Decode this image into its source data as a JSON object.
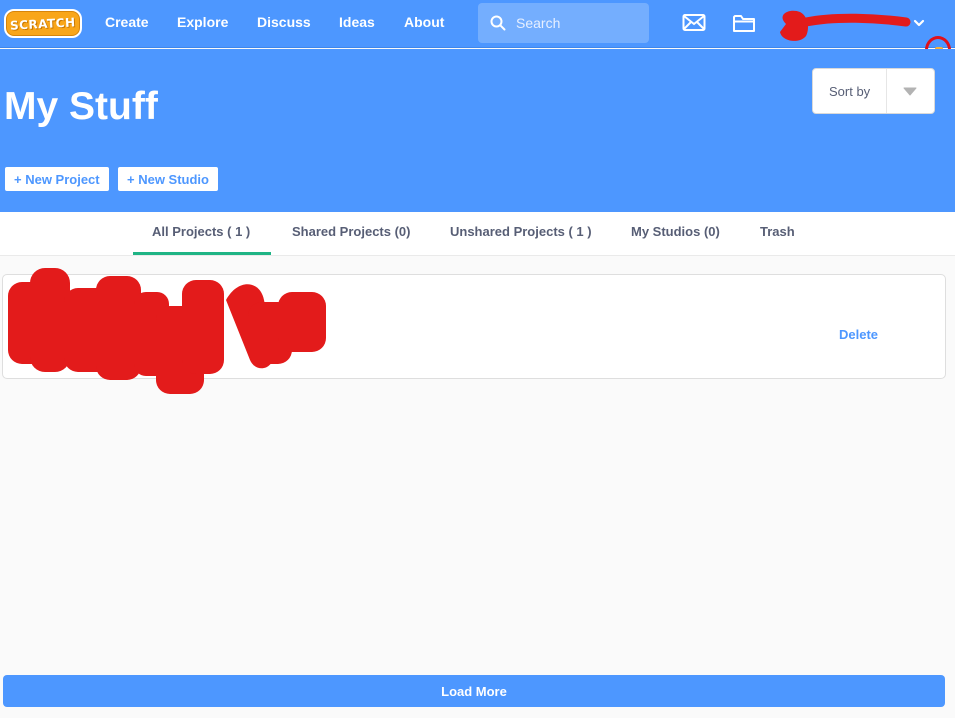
{
  "nav": {
    "logo_text": "SCRATCH",
    "links": [
      "Create",
      "Explore",
      "Discuss",
      "Ideas",
      "About"
    ],
    "search_placeholder": "Search"
  },
  "header": {
    "title": "My Stuff",
    "sort_label": "Sort by",
    "new_project_label": "+ New Project",
    "new_studio_label": "+ New Studio"
  },
  "tabs": [
    "All Projects ( 1 )",
    "Shared Projects (0)",
    "Unshared Projects ( 1 )",
    "My Studios (0)",
    "Trash"
  ],
  "active_tab": "All Projects ( 1 )",
  "projects": [
    {
      "action_label": "Delete"
    }
  ],
  "load_more_label": "Load More",
  "colors": {
    "brand_blue": "#4d97ff",
    "tab_accent": "#1fb485",
    "redaction": "#e31b1b"
  }
}
